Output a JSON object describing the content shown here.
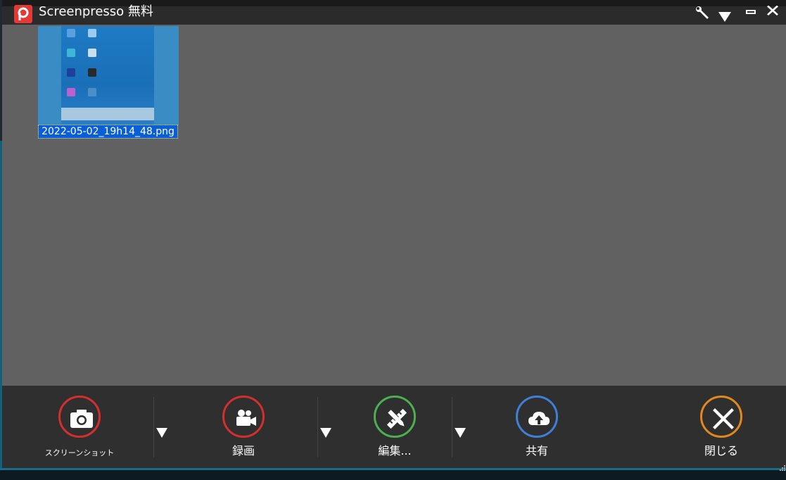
{
  "window": {
    "title": "Screenpresso 無料",
    "logo_letter": "P",
    "accent_color": "#e53935"
  },
  "titlebar_buttons": [
    {
      "name": "settings-wrench",
      "icon": "wrench-icon"
    },
    {
      "name": "menu-dropdown",
      "icon": "triangle-down-icon"
    },
    {
      "name": "minimize",
      "icon": "minimize-icon"
    },
    {
      "name": "close",
      "icon": "close-x-icon"
    }
  ],
  "thumbnail": {
    "filename": "2022-05-02_19h14_48.png",
    "selected": true
  },
  "toolbar": {
    "screenshot_label": "スクリーンショット",
    "record_label": "録画",
    "edit_label": "編集...",
    "share_label": "共有",
    "close_label": "閉じる",
    "colors": {
      "screenshot": "#d32f2f",
      "record": "#d32f2f",
      "edit": "#4caf50",
      "share": "#3f7fd6",
      "close": "#e08a1e"
    }
  }
}
